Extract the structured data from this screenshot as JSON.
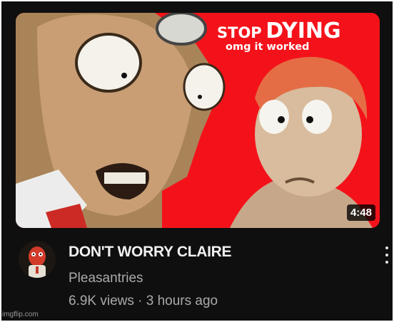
{
  "video": {
    "thumbnail_text_line1_prefix": "STOP",
    "thumbnail_text_line1_main": "DYING",
    "thumbnail_text_line2": "omg it worked",
    "duration": "4:48",
    "title": "DON'T WORRY CLAIRE",
    "channel": "Pleasantries",
    "views": "6.9K views",
    "separator": "·",
    "posted": "3 hours ago"
  },
  "icons": {
    "more": "more-vert-icon"
  },
  "watermark": "imgflip.com",
  "colors": {
    "background": "#0f0f0f",
    "thumbnail_red": "#f4121a",
    "title": "#f1f1f1",
    "secondary_text": "#aaaaaa"
  }
}
